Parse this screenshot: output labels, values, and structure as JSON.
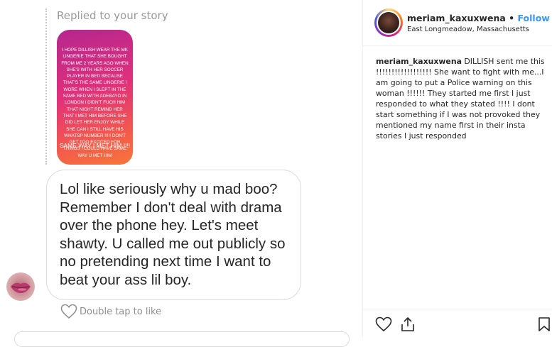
{
  "dm": {
    "replied_label": "Replied to your story",
    "story_text": "I hope Dillish wear the Mk lingerie that she bought from me 2 years ago when she's with her soccer player in bed because that's the same lingerie I wore when I slept in the same bed with Adebayo in London I didn't fuch him that night remind her that I met him before she did let her enjoy while she can I still have his whatsp number !!!!! Don't get too excited for things I could have same way u met him",
    "story_last_line": "SAME WAY I MET HIM !!!!",
    "message": "Lol like seriously why u mad boo? Remember I don't deal with drama over the phone hey. Let's meet shawty. U called me out publicly so no pretending next time I want to beat your ass lil boy.",
    "double_tap": "Double tap to like"
  },
  "post": {
    "username": "meriam_kaxuxwena",
    "separator": " • ",
    "follow_label": "Follow",
    "location": "East Longmeadow, Massachusetts",
    "caption_user": "meriam_kaxuxwena",
    "caption_text": " DILLISH sent me this !!!!!!!!!!!!!!!!!! She want to fight with me...I am going to put a Police warning on this woman !!!!!! They started me first I just responded to what they stated !!!! I dont start something if I was not provoked they mentioned my name first in their insta stories I just responded"
  },
  "icons": {
    "heart": "heart-icon",
    "share": "share-icon",
    "bookmark": "bookmark-icon"
  }
}
